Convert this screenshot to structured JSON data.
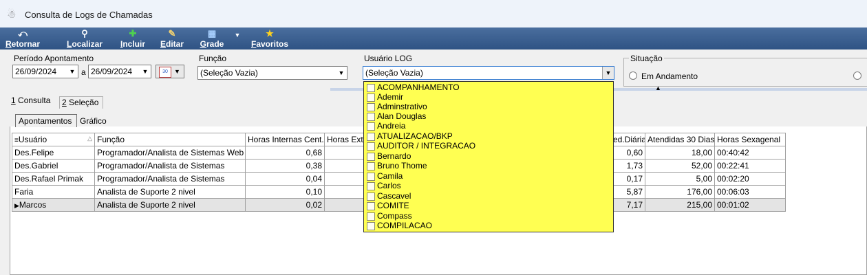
{
  "window": {
    "title": "Consulta de Logs de Chamadas"
  },
  "toolbar": {
    "retornar": {
      "pre": "",
      "u": "R",
      "post": "etornar"
    },
    "localizar": {
      "pre": "",
      "u": "L",
      "post": "ocalizar"
    },
    "incluir": {
      "pre": "",
      "u": "I",
      "post": "ncluir"
    },
    "editar": {
      "pre": "",
      "u": "E",
      "post": "ditar"
    },
    "grade": {
      "pre": "",
      "u": "G",
      "post": "rade"
    },
    "favoritos": {
      "pre": "",
      "u": "F",
      "post": "avoritos"
    }
  },
  "filters": {
    "periodo_label": "Período Apontamento",
    "date_from": "26/09/2024",
    "a_label": "a",
    "date_to": "26/09/2024",
    "funcao_label": "Função",
    "funcao_value": "(Seleção Vazia)",
    "usuario_label": "Usuário LOG",
    "usuario_value": "(Seleção Vazia)",
    "situacao_label": "Situação",
    "situacao_option": "Em Andamento"
  },
  "tabs": {
    "consulta": {
      "u": "1",
      "post": " Consulta"
    },
    "selecao": {
      "u": "2",
      "post": " Seleção"
    }
  },
  "subtabs": {
    "apontamentos": "Apontamentos",
    "grafico": "Gráfico"
  },
  "grid": {
    "headers": {
      "usuario": "Usuário",
      "funcao": "Função",
      "horas_internas": "Horas Internas Cent.",
      "horas_externas": "Horas Exte",
      "med_diaria": "ed.Diária",
      "atendidas": "Atendidas 30 Dias",
      "horas_sexagenal": "Horas Sexagenal"
    },
    "rows": [
      {
        "usuario": "Des.Felipe",
        "funcao": "Programador/Analista de Sistemas Web",
        "horas_internas": "0,68",
        "med_diaria": "0,60",
        "atendidas": "18,00",
        "horas_sexagenal": "00:40:42"
      },
      {
        "usuario": "Des.Gabriel",
        "funcao": "Programador/Analista de Sistemas",
        "horas_internas": "0,38",
        "med_diaria": "1,73",
        "atendidas": "52,00",
        "horas_sexagenal": "00:22:41"
      },
      {
        "usuario": "Des.Rafael Primak",
        "funcao": "Programador/Analista de Sistemas",
        "horas_internas": "0,04",
        "med_diaria": "0,17",
        "atendidas": "5,00",
        "horas_sexagenal": "00:02:20"
      },
      {
        "usuario": "Faria",
        "funcao": "Analista de Suporte 2 nivel",
        "horas_internas": "0,10",
        "med_diaria": "5,87",
        "atendidas": "176,00",
        "horas_sexagenal": "00:06:03"
      },
      {
        "usuario": "Marcos",
        "funcao": "Analista de Suporte 2 nivel",
        "horas_internas": "0,02",
        "med_diaria": "7,17",
        "atendidas": "215,00",
        "horas_sexagenal": "00:01:02"
      }
    ]
  },
  "dropdown": {
    "items": [
      "ACOMPANHAMENTO",
      "Ademir",
      "Adminstrativo",
      "Alan Douglas",
      "Andreia",
      "ATUALIZACAO/BKP",
      "AUDITOR / INTEGRACAO",
      "Bernardo",
      "Bruno Thome",
      "Camila",
      "Carlos",
      "Cascavel",
      "COMITE",
      "Compass",
      "COMPILACAO"
    ]
  },
  "colors": {
    "toolbar": "#3a5f91",
    "dropdown_bg": "#ffff52",
    "selected_row": "#e4e4e4"
  }
}
